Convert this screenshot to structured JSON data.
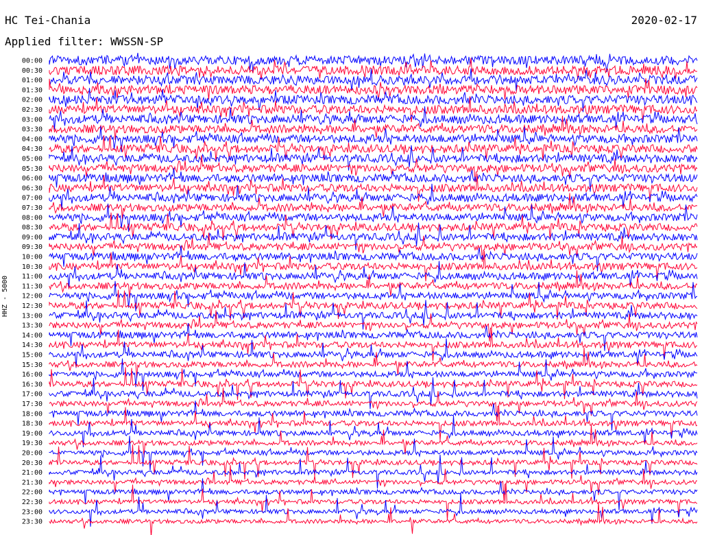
{
  "header": {
    "station": "HC Tei-Chania",
    "filter": "Applied filter: WWSSN-SP",
    "date": "2020-02-17"
  },
  "chart_data": {
    "type": "line",
    "title": "HC Tei-Chania",
    "date": "2020-02-17",
    "filter": "WWSSN-SP",
    "channel_label": "HHZ - 5000",
    "rows": [
      "00:00",
      "00:30",
      "01:00",
      "01:30",
      "02:00",
      "02:30",
      "03:00",
      "03:30",
      "04:00",
      "04:30",
      "05:00",
      "05:30",
      "06:00",
      "06:30",
      "07:00",
      "07:30",
      "08:00",
      "08:30",
      "09:00",
      "09:30",
      "10:00",
      "10:30",
      "11:00",
      "11:30",
      "12:00",
      "12:30",
      "13:00",
      "13:30",
      "14:00",
      "14:30",
      "15:00",
      "15:30",
      "16:00",
      "16:30",
      "17:00",
      "17:30",
      "18:00",
      "18:30",
      "19:00",
      "19:30",
      "20:00",
      "20:30",
      "21:00",
      "21:30",
      "22:00",
      "22:30",
      "23:00",
      "23:30"
    ],
    "row_minutes": 30,
    "trace_colors": [
      "#0000ff",
      "#ff0033"
    ],
    "grid": false
  }
}
